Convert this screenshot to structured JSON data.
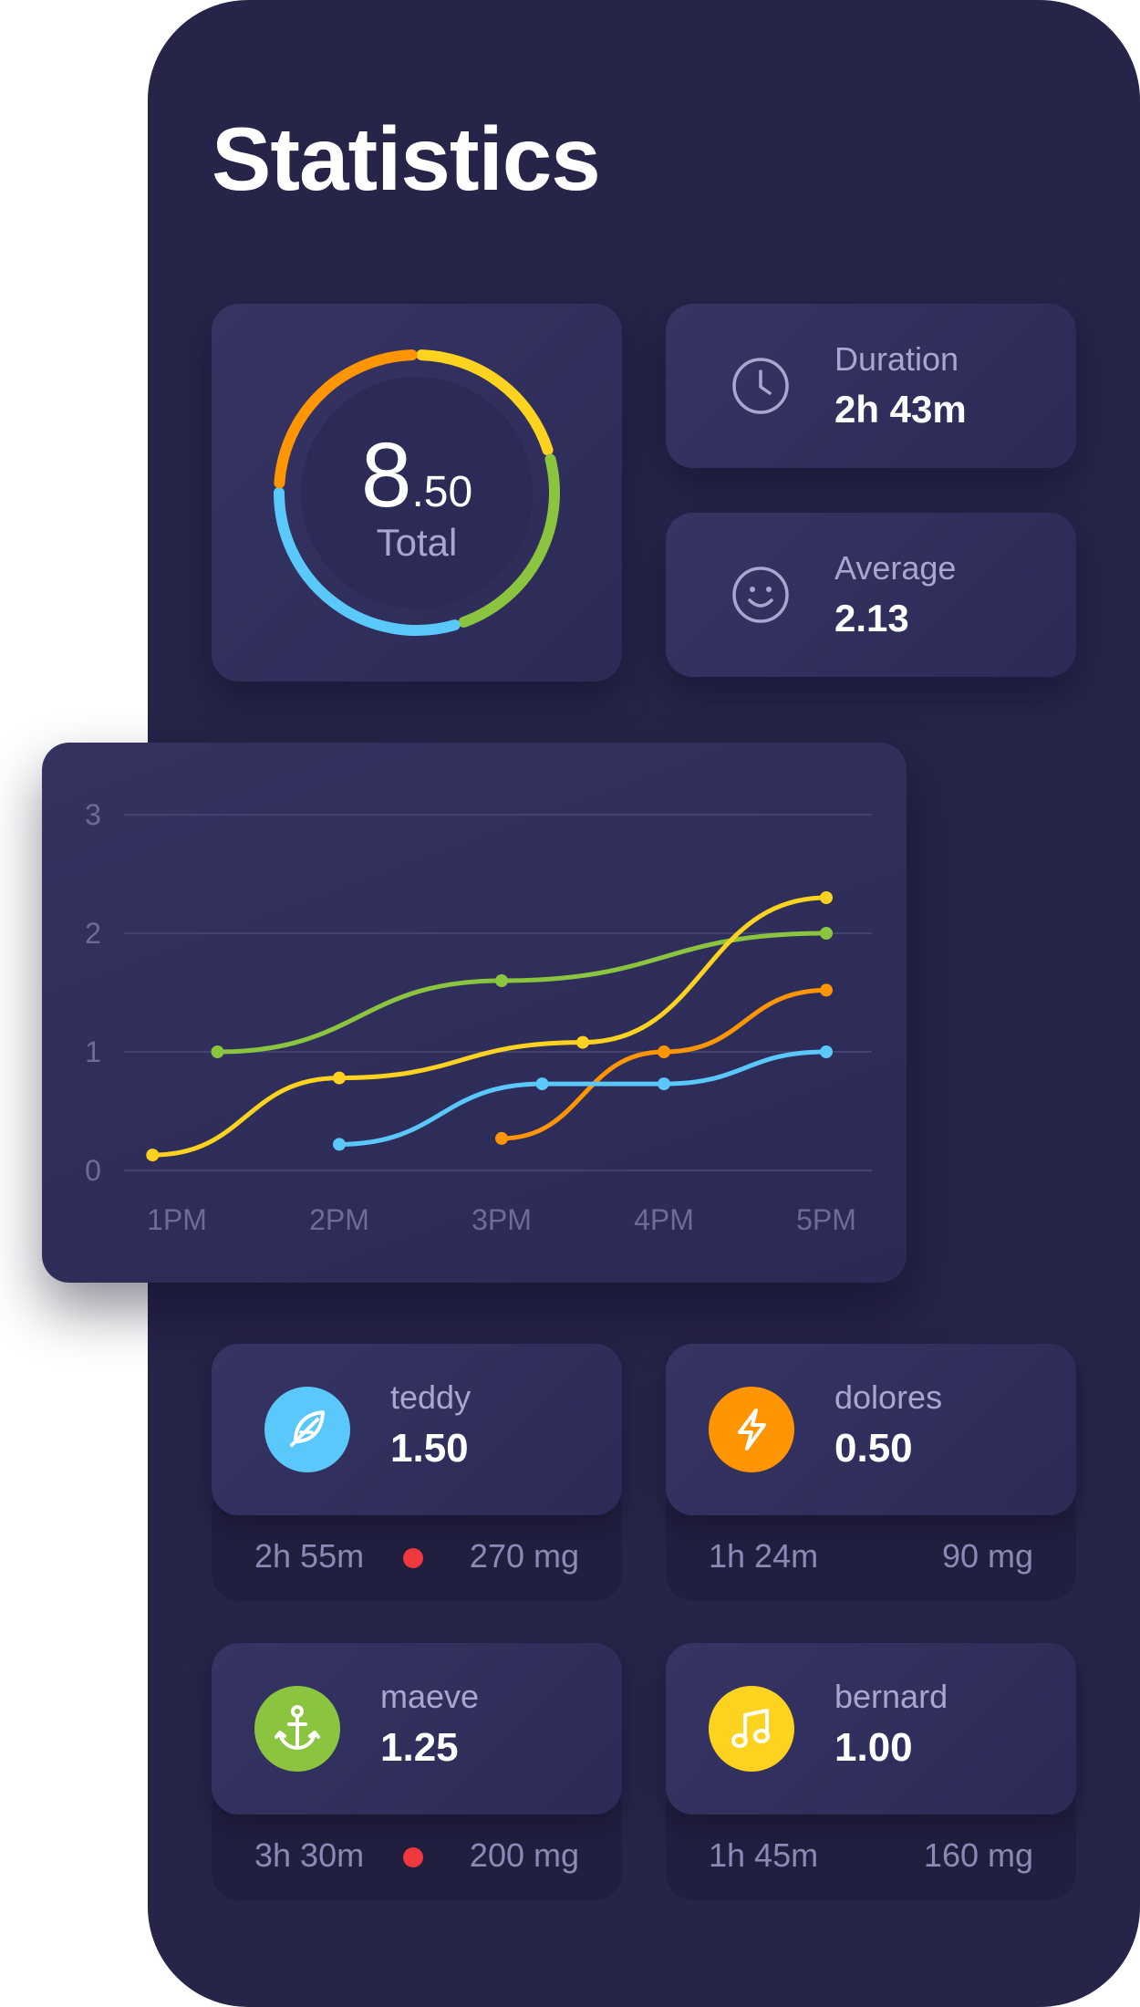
{
  "page": {
    "title": "Statistics"
  },
  "summary": {
    "total_int": "8",
    "total_dec": ".50",
    "total_label": "Total",
    "ring_colors": [
      "#fdd31f",
      "#8bc53f",
      "#5ac8fa",
      "#ff9500"
    ]
  },
  "stats": [
    {
      "label": "Duration",
      "value": "2h 43m",
      "icon": "clock-icon"
    },
    {
      "label": "Average",
      "value": "2.13",
      "icon": "smiley-icon"
    }
  ],
  "chart_data": {
    "type": "line",
    "categories": [
      "1PM",
      "2PM",
      "3PM",
      "4PM",
      "5PM"
    ],
    "ylim": [
      0,
      3
    ],
    "yticks": [
      "0",
      "1",
      "2",
      "3"
    ],
    "grid": true,
    "series": [
      {
        "color": "#8bc53f",
        "points": [
          [
            1.25,
            1.0
          ],
          [
            3.0,
            1.6
          ],
          [
            5.0,
            2.0
          ]
        ]
      },
      {
        "color": "#fdd31f",
        "points": [
          [
            0.85,
            0.13
          ],
          [
            2.0,
            0.78
          ],
          [
            3.5,
            1.08
          ],
          [
            5.0,
            2.3
          ]
        ]
      },
      {
        "color": "#ff9500",
        "points": [
          [
            3.0,
            0.27
          ],
          [
            4.0,
            1.0
          ],
          [
            5.0,
            1.52
          ]
        ]
      },
      {
        "color": "#5ac8fa",
        "points": [
          [
            2.0,
            0.22
          ],
          [
            3.25,
            0.73
          ],
          [
            4.0,
            0.73
          ],
          [
            5.0,
            1.0
          ]
        ]
      }
    ]
  },
  "people": [
    {
      "name": "teddy",
      "value": "1.50",
      "duration": "2h 55m",
      "dose": "270 mg",
      "alert": true,
      "color": "#5ac8fa",
      "icon": "feather-icon"
    },
    {
      "name": "dolores",
      "value": "0.50",
      "duration": "1h 24m",
      "dose": "90 mg",
      "alert": false,
      "color": "#ff9500",
      "icon": "lightning-icon"
    },
    {
      "name": "maeve",
      "value": "1.25",
      "duration": "3h 30m",
      "dose": "200 mg",
      "alert": true,
      "color": "#8bc53f",
      "icon": "anchor-icon"
    },
    {
      "name": "bernard",
      "value": "1.00",
      "duration": "1h 45m",
      "dose": "160 mg",
      "alert": false,
      "color": "#fdd31f",
      "icon": "music-note-icon"
    }
  ]
}
